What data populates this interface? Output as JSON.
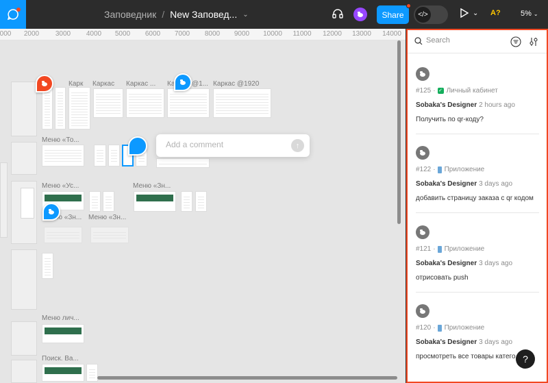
{
  "topbar": {
    "project": "Заповедник",
    "separator": "/",
    "file_name": "New Заповед...",
    "share_label": "Share",
    "a11y_label": "A?",
    "zoom_label": "5%",
    "icons": [
      "main-menu-icon",
      "headphones-icon",
      "chevron-down-icon",
      "code-icon",
      "play-icon"
    ]
  },
  "ruler": {
    "ticks": [
      "000",
      "2000",
      "3000",
      "4000",
      "5000",
      "6000",
      "7000",
      "8000",
      "9000",
      "10000",
      "11000",
      "12000",
      "13000",
      "14000"
    ]
  },
  "canvas": {
    "frame_labels": [
      "Карк",
      "Каркас",
      "Каркас ...",
      "Ка",
      "@1...",
      "Каркас @1920",
      "Меню «То...",
      "Меню «Ус...",
      "Меню «Зн...",
      "Меню «Зн...",
      "Меню «Зн...",
      "Меню лич...",
      "Поиск. Ва..."
    ],
    "comment_placeholder": "Add a comment"
  },
  "panel": {
    "search_placeholder": "Search",
    "threads": [
      {
        "number": "#125",
        "page_icon": "check",
        "page": "Личный кабинет",
        "author": "Sobaka's Designer",
        "time": "2 hours ago",
        "message": "Получить по qr-коду?"
      },
      {
        "number": "#122",
        "page_icon": "phone",
        "page": "Приложение",
        "author": "Sobaka's Designer",
        "time": "3 days ago",
        "message": "добавить страницу заказа с qr кодом"
      },
      {
        "number": "#121",
        "page_icon": "phone",
        "page": "Приложение",
        "author": "Sobaka's Designer",
        "time": "3 days ago",
        "message": "отрисовать push"
      },
      {
        "number": "#120",
        "page_icon": "phone",
        "page": "Приложение",
        "author": "Sobaka's Designer",
        "time": "3 days ago",
        "message": "просмотреть все товары катего"
      }
    ],
    "help_label": "?"
  },
  "colors": {
    "accent": "#0d99ff",
    "alert": "#f24822",
    "topbar_bg": "#2c2c2c",
    "canvas_bg": "#e5e5e5"
  }
}
